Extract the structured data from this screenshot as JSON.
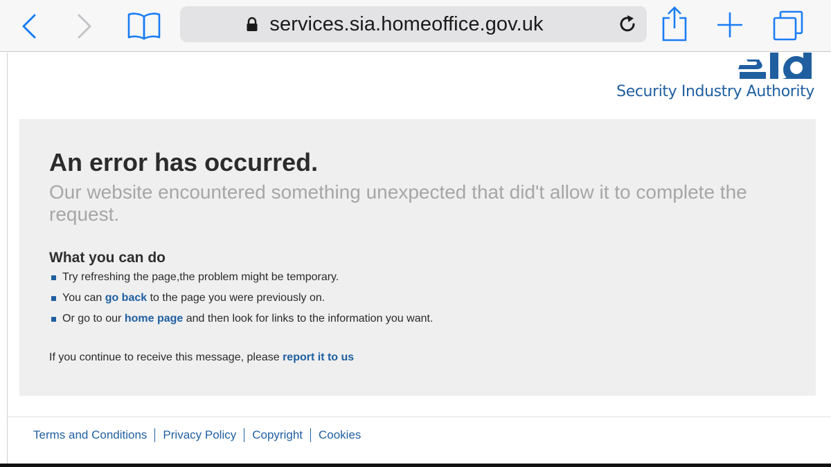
{
  "browser": {
    "url": "services.sia.homeoffice.gov.uk",
    "icons": {
      "back": "chevron-left-icon",
      "forward": "chevron-right-icon",
      "bookmarks": "book-icon",
      "lock": "lock-icon",
      "reload": "reload-icon",
      "share": "share-icon",
      "new_tab": "plus-icon",
      "tabs": "tabs-icon"
    },
    "accent_color": "#1a7cf5"
  },
  "header": {
    "logo_mark": "sia",
    "logo_text": "Security Industry Authority"
  },
  "error": {
    "title": "An error has occurred.",
    "description": "Our website encountered something unexpected that did't allow it to complete the request.",
    "what_you_can_do": "What you can do",
    "items": [
      {
        "text": "Try refreshing the page,the problem might be temporary."
      },
      {
        "before": "You can ",
        "link": "go back",
        "after": " to the page you were previously on."
      },
      {
        "before": "Or go to our ",
        "link": "home page",
        "after": " and then look for links to the information you want."
      }
    ],
    "contact_before": "If you continue to receive this message, please ",
    "contact_link": "report it to us"
  },
  "footer": {
    "links": [
      "Terms and Conditions",
      "Privacy Policy",
      "Copyright",
      "Cookies"
    ]
  },
  "colors": {
    "brand_blue": "#1f5fa0",
    "panel_bg": "#efefef",
    "muted_text": "#a6a6a6"
  }
}
